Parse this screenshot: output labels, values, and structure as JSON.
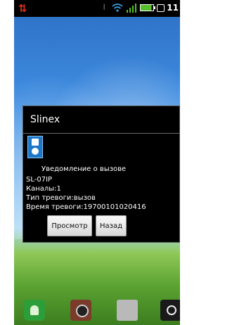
{
  "status_bar": {
    "time": "11"
  },
  "dialog": {
    "title": "Slinex",
    "heading": "Уведомление о вызове",
    "lines": [
      "SL-07IP",
      "Каналы:1",
      "Тип тревоги:вызов",
      "Время тревоги:19700101020416"
    ],
    "buttons": {
      "view": "Просмотр",
      "back": "Назад"
    }
  },
  "dock": {
    "icons": [
      "phone-icon",
      "camera-icon",
      "box-icon",
      "record-icon"
    ]
  },
  "colors": {
    "dialog_bg": "#000000",
    "status_bar_bg": "#000000",
    "alert_arrows": "#e0301e"
  }
}
